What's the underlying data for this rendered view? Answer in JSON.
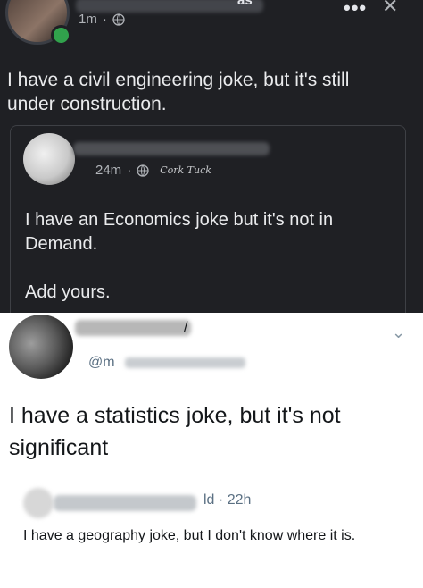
{
  "fb_post": {
    "author_initials": "as",
    "time": "1m",
    "text": "I have a civil engineering joke, but it's still under construction."
  },
  "shared_post": {
    "time": "24m",
    "signature": "Cork Tuck",
    "text": "I have an Economics joke but it's not in Demand.",
    "footer": "Add yours."
  },
  "tweet": {
    "name_suffix": "/",
    "handle": "@m",
    "text": "I have a statistics joke, but it's not significant"
  },
  "reply": {
    "name_fragment": "ld",
    "time": "22h",
    "text": "I have a geography joke, but I don't know where it is."
  },
  "icons": {
    "globe": "globe-icon",
    "more": "more-dots-icon",
    "close": "close-icon",
    "chevron": "chevron-down-icon"
  },
  "colors": {
    "dark_bg": "#1f2024",
    "online": "#31a24c",
    "twitter_secondary": "#5b7083"
  }
}
